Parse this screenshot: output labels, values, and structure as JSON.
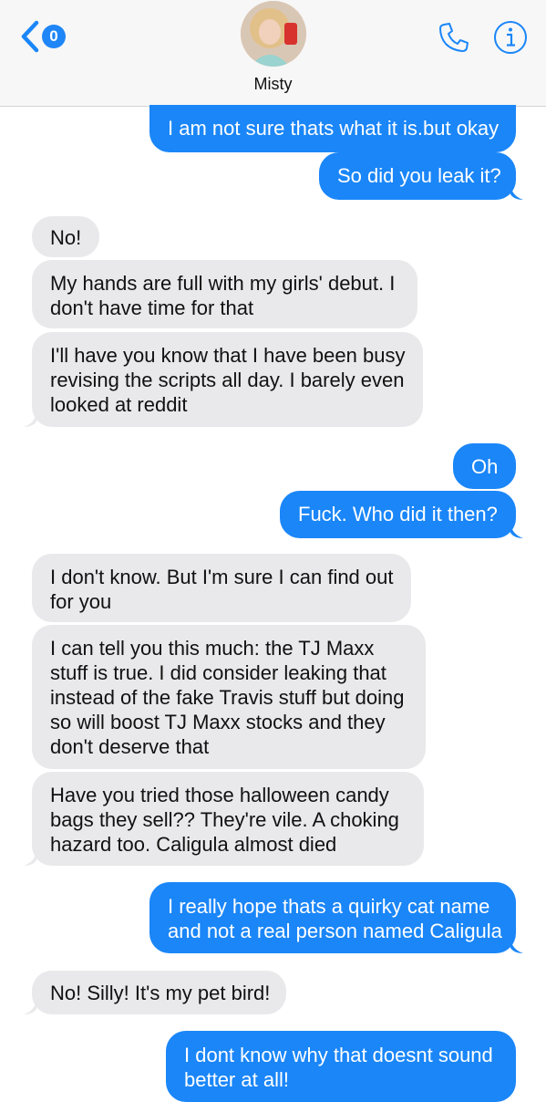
{
  "header": {
    "back_count": "0",
    "contact_name": "Misty",
    "back_icon": "chevron-left-icon",
    "call_icon": "phone-icon",
    "info_icon": "info-icon",
    "accent_color": "#1a86f8"
  },
  "messages": [
    {
      "from": "me",
      "text": "I am not sure thats what it is.but okay"
    },
    {
      "from": "me",
      "text": "So did you leak it?"
    },
    {
      "from": "them",
      "text": "No!"
    },
    {
      "from": "them",
      "lines": [
        "My hands are full with my girls' debut. I",
        "don't have time for that"
      ]
    },
    {
      "from": "them",
      "lines": [
        "I'll have you know that I have been busy",
        "revising the scripts all day. I barely even",
        "looked at reddit"
      ]
    },
    {
      "from": "me",
      "text": "Oh"
    },
    {
      "from": "me",
      "text": "Fuck. Who did it then?"
    },
    {
      "from": "them",
      "lines": [
        "I don't know. But I'm sure I can find out",
        "for you"
      ]
    },
    {
      "from": "them",
      "lines": [
        "I can tell you this much: the TJ Maxx",
        "stuff is true. I did consider leaking that",
        "instead of the fake Travis stuff but doing",
        "so will boost TJ Maxx stocks and they",
        "don't deserve that"
      ]
    },
    {
      "from": "them",
      "lines": [
        "Have you tried those halloween candy",
        "bags they sell?? They're vile. A choking",
        "hazard too. Caligula almost died"
      ]
    },
    {
      "from": "me",
      "lines": [
        "I really hope thats a quirky cat name",
        "and not a real person named Caligula"
      ]
    },
    {
      "from": "them",
      "text": "No! Silly! It's my pet bird!"
    },
    {
      "from": "me",
      "lines": [
        "I dont know why that doesnt sound",
        "better at all!"
      ]
    }
  ]
}
